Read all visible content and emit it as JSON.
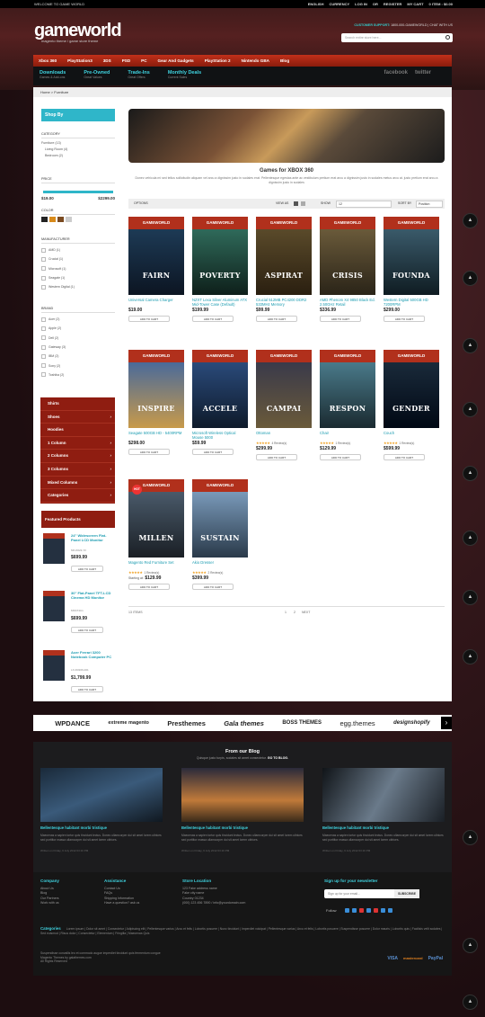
{
  "topbar": {
    "welcome": "WELCOME TO GAME WORLD",
    "lang": "ENGLISH",
    "currency": "CURRENCY",
    "login": "LOG IN",
    "or": "OR",
    "register": "REGISTER",
    "cart": "MY CART",
    "cart_items": "0 ITEM : $0.00"
  },
  "header": {
    "logo": "gameworld",
    "tagline": "magento theme / game store theme",
    "support_label": "CUSTOMER SUPPORT:",
    "support_phone": "1800-000-GAMEWORLD",
    "chat": "CHAT WITH US",
    "search_placeholder": "Search entire store here..."
  },
  "nav": [
    "Xbox 360",
    "PlayStation3",
    "3DS",
    "PSD",
    "PC",
    "Gear And Gadgets",
    "PlayStation 2",
    "Nintendo GBA",
    "Blog"
  ],
  "subnav": [
    {
      "t": "Downloads",
      "s": "Games & Add-ons"
    },
    {
      "t": "Pre-Owned",
      "s": "Great Values"
    },
    {
      "t": "Trade-Ins",
      "s": "Great Offers"
    },
    {
      "t": "Monthly Deals",
      "s": "Current Sales"
    }
  ],
  "social": [
    "facebook",
    "twitter"
  ],
  "breadcrumb": "Home  >  Furniture",
  "sidebar": {
    "shopby": "Shop By",
    "category": "CATEGORY",
    "cats": [
      "Furniture (13)",
      "Living Room (4)",
      "Bedroom (2)"
    ],
    "price": "PRICE",
    "pmin": "$19.00",
    "pmax": "$2299.00",
    "color": "COLOR",
    "manufacturer": "MANUFACTURER",
    "manus": [
      "AMD (1)",
      "Crucial (1)",
      "Microsoft (1)",
      "Seagate (1)",
      "Western Digital (1)"
    ],
    "brand": "BRAND",
    "brands": [
      "Acer (2)",
      "Apple (2)",
      "Dell (2)",
      "Gateway (3)",
      "IBM (2)",
      "Sony (2)",
      "Toshiba (2)"
    ],
    "menu": [
      "Shirts",
      "Shoes",
      "Hoodies",
      "1 Column",
      "2 Columns",
      "3 Columns",
      "Mixed Columns",
      "Categories"
    ],
    "featured": "Featured Products",
    "fproducts": [
      {
        "n": "24\" Widescreen Flat-Panel LCD Monitor",
        "sku": "MN-6623-YF",
        "p": "$699.99"
      },
      {
        "n": "30\" Flat-Panel TFT-LCD Cinema HD Monitor",
        "sku": "MSST4C1",
        "p": "$699.99"
      },
      {
        "n": "Acer Ferrari 3200 Notebook Computer PC",
        "sku": "LX-FR206-001",
        "p": "$1,799.99"
      }
    ],
    "addcart": "ADD TO CART"
  },
  "main": {
    "title": "Games for XBOX 360",
    "desc": "Donec vehicula mi sed tellus sollicitudin aliquam vel arcu a dignissim justo in sodales erat. Pellentesque egestas ante ac vestibulum pretium erat arcu a dignissim justo in sodales metus arcu at. justo pretium erat arcu a dignissim justo in sodales",
    "options": "OPTIONS",
    "viewas": "VIEW AS",
    "show": "SHOW",
    "show_val": "12",
    "sortby": "SORT BY",
    "sort_val": "Position",
    "items": "13 ITEMS",
    "pages": [
      "1",
      "2",
      "NEXT"
    ]
  },
  "products": [
    {
      "name": "Universal Camera Charger",
      "price": "$19.00",
      "art": "FAIRN",
      "c1": "#1d3a55",
      "c2": "#0c1522",
      "rating": ""
    },
    {
      "name": "NZXT Lexa Silver Aluminum ATX Mid-Tower Case (Default)",
      "price": "$199.99",
      "art": "POVERTY",
      "c1": "#2f6a5a",
      "c2": "#0e1f1a",
      "rating": ""
    },
    {
      "name": "Crucial 512MB PC4200 DDR2 533MHz Memory",
      "price": "$99.99",
      "art": "ASPIRAT",
      "c1": "#5a4a2a",
      "c2": "#2a1f10",
      "rating": ""
    },
    {
      "name": "AMD Phenom X4 9850 Black Ed. 2.50GHz Retail",
      "price": "$336.99",
      "art": "CRISIS",
      "c1": "#6a5a3a",
      "c2": "#2a2418",
      "rating": ""
    },
    {
      "name": "Western Digital 500GB HD 7200RPM",
      "price": "$299.00",
      "art": "FOUNDA",
      "c1": "#3a5a6a",
      "c2": "#0f1c22",
      "rating": ""
    },
    {
      "name": "Seagate 500GB HD - 5400RPM",
      "price": "$298.00",
      "art": "INSPIRE",
      "c1": "#4a6a9a",
      "c2": "#c89a4a",
      "rating": ""
    },
    {
      "name": "Microsoft Wireless Optical Mouse 5000",
      "price": "$59.99",
      "art": "ACCELE",
      "c1": "#2a4a7a",
      "c2": "#0e1a2a",
      "rating": ""
    },
    {
      "name": "Ottoman",
      "price": "$299.99",
      "art": "CAMPAI",
      "c1": "#3a3a4a",
      "c2": "#6a5a3a",
      "rating": "4 Review(s)"
    },
    {
      "name": "Chair",
      "price": "$129.99",
      "art": "RESPON",
      "c1": "#4a7a8a",
      "c2": "#1a2a30",
      "rating": "1 Review(s)"
    },
    {
      "name": "Couch",
      "price": "$599.99",
      "art": "GENDER",
      "c1": "#1a2a3a",
      "c2": "#000814",
      "rating": "1 Review(s)"
    },
    {
      "name": "Magento Red Furniture Set",
      "price": "$129.99",
      "price_prefix": "Starting at:",
      "art": "MILLEN",
      "c1": "#4a5a6a",
      "c2": "#1a1f25",
      "rating": "1 Review(s)",
      "hot": "HOT"
    },
    {
      "name": "Akio Dresser",
      "price": "$399.99",
      "art": "SUSTAIN",
      "c1": "#7a9aba",
      "c2": "#2a3a4a",
      "rating": "2 Review(s)"
    }
  ],
  "product_header": "GAMEWORLD",
  "brands": [
    "WPDANCE",
    "extreme magento",
    "Presthemes",
    "Gala themes",
    "BOSS THEMES",
    "egg.themes",
    "designshopify"
  ],
  "blog": {
    "title": "From our Blog",
    "sub": "Quisque justo turpis, sodales sit amet consectetur.",
    "goto": "GO TO BLOG.",
    "posts": [
      {
        "t": "Bellentesque habitant morbi tristique",
        "d": "Maecenas a sapien tortor quis tincidunt lectus. Donec ullamcorper dui sit amet lorem ultrices sed porttitor massa ullamcorper dui sit amet lorem ultrices.",
        "m": "Written on Friday, 6 July 2012 03:16 PM"
      },
      {
        "t": "Bellentesque habitant morbi tristique",
        "d": "Maecenas a sapien tortor quis tincidunt lectus. Donec ullamcorper dui sit amet lorem ultrices sed porttitor massa ullamcorper dui sit amet lorem ultrices.",
        "m": "Written on Friday, 6 July 2012 03:16 PM"
      },
      {
        "t": "Bellentesque habitant morbi tristique",
        "d": "Maecenas a sapien tortor quis tincidunt lectus. Donec ullamcorper dui sit amet lorem ultrices sed porttitor massa ullamcorper dui sit amet lorem ultrices.",
        "m": "Written on Friday, 6 July 2012 03:16 PM"
      }
    ]
  },
  "footer": {
    "company": {
      "h": "Company",
      "items": [
        "About Us",
        "Blog",
        "Our Partners",
        "Work with us"
      ]
    },
    "assistance": {
      "h": "Assistance",
      "items": [
        "Contact Us",
        "FAQs",
        "Shipping Information",
        "Have a question? ask us"
      ]
    },
    "store": {
      "h": "Store Location",
      "items": [
        "123 Fake address name",
        "Fake city name",
        "Country 01234",
        "(000) 123 456 7890 / info@yourdomain.com"
      ]
    },
    "signup": "Sign up for your newsletter",
    "email_ph": "Sign up for your email...",
    "subscribe": "SUBSCRIBE",
    "follow": "Follow",
    "cats_label": "Categories",
    "cats": "Lorem ipsum | Dolor sit amet | Consectetur | Adipiscing elit | Pellentesque varius | Arcu et felis | Lobortis posuere | Nunc tincidunt | Imperdiet volutpat | Pellentesque varius | Arcu et felis | Lobortis posuere | Suspendisse posuere | Dolor mauris | Lobortis quis | Facilisis velit sodales | Sed euismod | Risus dolor | Consectetur | Elementum | Fringilla | Maecenas Quis",
    "copy": [
      "Suspendisse convallis leo et commodo augue imperdiet tincidunt quis fermentum congue",
      "Magento Themes by galathemes.com",
      "All Rights Reserved"
    ],
    "pay": [
      "VISA",
      "mastercard",
      "PayPal"
    ]
  },
  "colors": {
    "accent": "#2fb6c9",
    "nav_red": "#b1301c",
    "brand_red": "#8f1d11"
  }
}
